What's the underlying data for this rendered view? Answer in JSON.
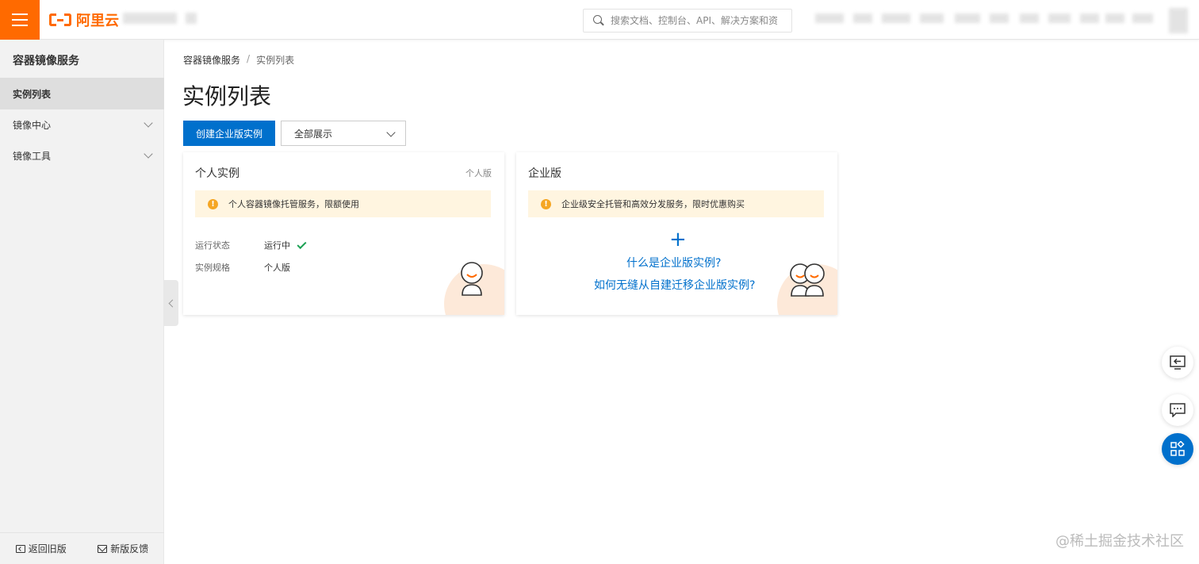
{
  "topbar": {
    "logo_text": "阿里云",
    "search_placeholder": "搜索文档、控制台、API、解决方案和资"
  },
  "sidebar": {
    "title": "容器镜像服务",
    "items": [
      {
        "label": "实例列表",
        "active": true
      },
      {
        "label": "镜像中心",
        "expandable": true
      },
      {
        "label": "镜像工具",
        "expandable": true
      }
    ],
    "footer": {
      "back_label": "返回旧版",
      "feedback_label": "新版反馈"
    }
  },
  "breadcrumb": {
    "parent": "容器镜像服务",
    "separator": "/",
    "current": "实例列表"
  },
  "page": {
    "title": "实例列表",
    "create_button": "创建企业版实例",
    "filter_select": "全部展示"
  },
  "cards": {
    "personal": {
      "title": "个人实例",
      "tag": "个人版",
      "notice": "个人容器镜像托管服务，限额使用",
      "status_label": "运行状态",
      "status_value": "运行中",
      "spec_label": "实例规格",
      "spec_value": "个人版"
    },
    "enterprise": {
      "title": "企业版",
      "notice": "企业级安全托管和高效分发服务，限时优惠购买",
      "plus": "+",
      "link1": "什么是企业版实例?",
      "link2": "如何无缝从自建迁移企业版实例?"
    }
  },
  "watermark": "@稀土掘金技术社区",
  "colors": {
    "brand": "#ff6a00",
    "primary": "#0070cc",
    "notice_bg": "#fff5e0",
    "warn": "#f5a623",
    "success": "#1aa053"
  },
  "icons": [
    "menu-icon",
    "search-icon",
    "chevron-down-icon",
    "warning-icon",
    "check-icon",
    "collapse-icon",
    "exit-icon",
    "chat-icon",
    "apps-icon"
  ]
}
